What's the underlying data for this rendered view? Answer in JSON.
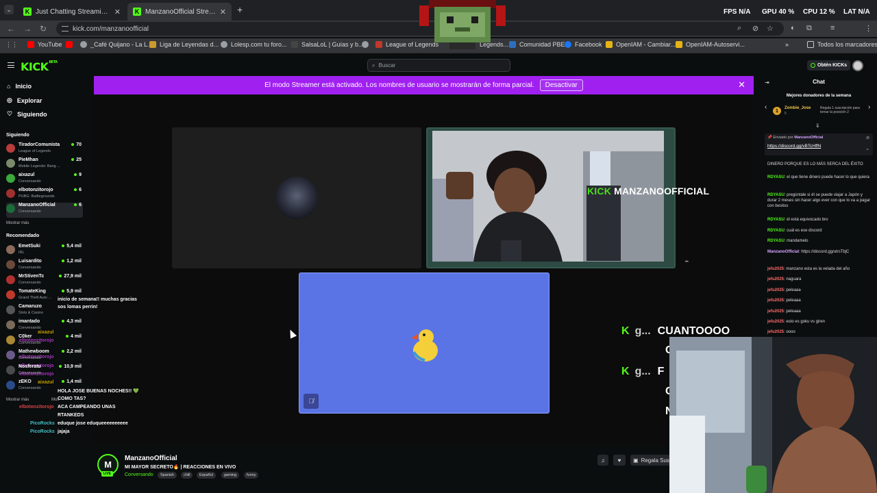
{
  "browser": {
    "tabs": [
      {
        "label": "Just Chatting Streaming - Live S"
      },
      {
        "label": "ManzanoOfficial Stream - Watc"
      }
    ],
    "url": "kick.com/manzanoofficial",
    "bookmarks": [
      {
        "label": "YouTube",
        "color": "#ff0000"
      },
      {
        "label": "_Café Quijano - La L...",
        "color": "#ff0000"
      },
      {
        "label": "Liga de Leyendas d...",
        "color": "#c99b2e"
      },
      {
        "label": "Lolesp.com tu foro...",
        "color": "#9aa0a6"
      },
      {
        "label": "SalsaLoL | Guías y b...",
        "color": "#3a3a3a"
      },
      {
        "label": "",
        "color": "#9aa0a6"
      },
      {
        "label": "League of Legends",
        "color": "#c0392b"
      },
      {
        "label": "Legends...",
        "color": "#555"
      },
      {
        "label": "Comunidad PBE",
        "color": "#2d6fbf"
      },
      {
        "label": "Facebook",
        "color": "#1877f2"
      },
      {
        "label": "OpenIAM - Cambiar...",
        "color": "#e7b416"
      },
      {
        "label": "OpenIAM-Autoservi...",
        "color": "#e7b416"
      }
    ],
    "all_bookmarks": "Todos los marcadores"
  },
  "overlay_stats": {
    "fps_label": "FPS",
    "fps": "N/A",
    "gpu_label": "GPU",
    "gpu": "40 %",
    "cpu_label": "CPU",
    "cpu": "12 %",
    "lat_label": "LAT",
    "lat": "N/A"
  },
  "kick": {
    "logo": "KICK",
    "logo_tag": "BETA",
    "search_placeholder": "Buscar",
    "get_kicks": "Obtén KICKs",
    "nav": {
      "home": "Inicio",
      "explore": "Explorar",
      "following": "Siguiendo"
    },
    "following_title": "Siguiendo",
    "following": [
      {
        "name": "TiradorComunista",
        "category": "League of Legends",
        "viewers": "70",
        "color": "#b83c3c"
      },
      {
        "name": "PieMhan",
        "category": "Mobile Legends: Bang ...",
        "viewers": "25",
        "color": "#7a8a6a"
      },
      {
        "name": "aixazul",
        "category": "Conversando",
        "viewers": "9",
        "color": "#3aa83a"
      },
      {
        "name": "elbotonzitorojo",
        "category": "PUBG: Battlegrounds",
        "viewers": "6",
        "color": "#a03030"
      },
      {
        "name": "ManzanoOfficial",
        "category": "Conversando",
        "viewers": "6",
        "color": "#1c6b3a"
      }
    ],
    "show_more": "Mostrar más",
    "recommended_title": "Recomendado",
    "recommended": [
      {
        "name": "EmetSuki",
        "category": "IRL",
        "viewers": "5,4 mil",
        "color": "#8c6a5a"
      },
      {
        "name": "Luisardito",
        "category": "Conversando",
        "viewers": "1,2 mil",
        "color": "#6a4a3a"
      },
      {
        "name": "MrStivenTc",
        "category": "Conversando",
        "viewers": "27,9 mil",
        "color": "#b03030"
      },
      {
        "name": "TomateKing",
        "category": "Grand Theft Auto ...",
        "viewers": "5,9 mil",
        "color": "#c0392b"
      },
      {
        "name": "Camaruzo",
        "category": "Slots & Casino",
        "viewers": "",
        "color": "#555555"
      },
      {
        "name": "imantado",
        "category": "Conversando",
        "viewers": "4,3 mil",
        "color": "#7a6a5a"
      },
      {
        "name": "C0ker",
        "category": "Conversando",
        "viewers": "4 mil",
        "color": "#aa8833"
      },
      {
        "name": "Mathewboom",
        "category": "Conversando",
        "viewers": "2,2 mil",
        "color": "#6a5a8a"
      },
      {
        "name": "Nosferatu",
        "category": "Conversando",
        "viewers": "10,9 mil",
        "color": "#4a4a4a"
      },
      {
        "name": "zEKO",
        "category": "Conversando",
        "viewers": "1,4 mil",
        "color": "#2a4a8a"
      }
    ],
    "show_more_2": "Mostrar más",
    "show_more_2b": "Mos"
  },
  "banner": {
    "text": "El modo Streamer está activado. Los nombres de usuario se mostrarán de forma parcial.",
    "button": "Desactivar",
    "close": "✕"
  },
  "video": {
    "cam_text_brand": "KICK",
    "cam_text": "MANZANOOFFICIAL",
    "kg_lines": [
      {
        "g": "g...",
        "text": "CUANTOOOO"
      },
      {
        "g": "g...",
        "text": ""
      }
    ],
    "kg_partial": [
      "C",
      "F",
      "C",
      "N"
    ]
  },
  "overlay_chat": [
    {
      "user": "",
      "text": "inicio de semana!! muchas gracias",
      "color": "#ffffff"
    },
    {
      "user": "",
      "text": "sos lomas perrin!",
      "color": "#ffffff"
    },
    {
      "user": "aixazul",
      "text": "",
      "color": "#c9a400"
    },
    {
      "user": "elbotonzitorojo",
      "text": "",
      "color": "#a83bc0"
    },
    {
      "user": "elbotonzitorojo",
      "text": "",
      "color": "#a83bc0"
    },
    {
      "user": "elbotonzitorojo",
      "text": "",
      "color": "#a83bc0"
    },
    {
      "user": "elbotonzitorojo",
      "text": "",
      "color": "#a83bc0"
    },
    {
      "user": "aixazul",
      "text": "",
      "color": "#c9a400"
    },
    {
      "user": "",
      "text": "HOLA JOSE BUENAS NOCHES!! 💚",
      "color": "#ffffff"
    },
    {
      "user": "",
      "text": "COMO TAS?",
      "color": "#ffffff"
    },
    {
      "user": "elbotonzitorojo",
      "text": "ACA CAMPEANDO UNAS",
      "color": "#d94b4b"
    },
    {
      "user": "",
      "text": "RTANKEDS",
      "color": "#ffffff"
    },
    {
      "user": "PicoRocks",
      "text": "eduque jose eduqueeeeeeeeee",
      "color": "#4bc2c9"
    },
    {
      "user": "PicoRocks",
      "text": "jajaja",
      "color": "#4bc2c9"
    }
  ],
  "stream_info": {
    "avatar_letter": "M",
    "live": "LIVE",
    "name": "ManzanoOfficial",
    "title": "MI MAYOR SECRETO🔥 | REACCIONES EN VIVO",
    "category": "Conversando",
    "tags": [
      "Spanish",
      "chill",
      "Español",
      "gaming",
      "funny"
    ],
    "gift_label": "Regala Sus"
  },
  "chat": {
    "title": "Chat",
    "donors_title": "Mejores donadores de la semana",
    "donor": {
      "rank": "1",
      "name": "Zombie_Jose",
      "amount": "5",
      "gift_text": "Regala 1 suscripción para tomar la posición 2"
    },
    "pinned_by": "Enviado por",
    "pinned_user": "ManzanoOfficial",
    "pinned_link": "https://discord.gg/vBTcHffN",
    "messages": [
      {
        "user": "",
        "text": "DINERO PORQUE ES LO MÁS SERCA DEL ÉXITO",
        "uc": ""
      },
      {
        "user": "RDYASU",
        "text": ": el que tiene dinero puede hacer lo que quiera",
        "uc": ""
      },
      {
        "user": "RDYASU",
        "text": ": pregúntale si él se puede viajar a Japón y durar 2 meses sin hacer algo ever con que lo va a pagar con besitos",
        "uc": ""
      },
      {
        "user": "RDYASU",
        "text": ": él está equivocado bro",
        "uc": ""
      },
      {
        "user": "RDYASU",
        "text": ": cuál es ese discord",
        "uc": ""
      },
      {
        "user": "RDYASU",
        "text": ": mandamelo",
        "uc": ""
      },
      {
        "user": "ManzanoOfficial",
        "text": ": https://discord.gg/utrsTbjC",
        "uc": "p"
      },
      {
        "user": "jefu2025",
        "text": ": manzano esta es la velada del año",
        "uc": "r"
      },
      {
        "user": "jefu2025",
        "text": ": naguara",
        "uc": "r"
      },
      {
        "user": "jefu2025",
        "text": ": peleaaa",
        "uc": "r"
      },
      {
        "user": "jefu2025",
        "text": ": peleaaa",
        "uc": "r"
      },
      {
        "user": "jefu2025",
        "text": ": peleaaa",
        "uc": "r"
      },
      {
        "user": "jefu2025",
        "text": ": esto es goku vs giren",
        "uc": "r"
      },
      {
        "user": "jefu2025",
        "text": ": oooo",
        "uc": "r"
      }
    ]
  },
  "colors": {
    "kick_green": "#53fc18",
    "banner_purple": "#a020f0",
    "tile_blue": "#5a74e5",
    "cam_border": "#2d4a43"
  },
  "icons": [
    "menu-icon",
    "search-icon",
    "home-icon",
    "compass-icon",
    "heart-icon",
    "close-icon",
    "mic-muted-icon",
    "bell-icon",
    "gift-icon",
    "chevron-left-icon",
    "chevron-right-icon",
    "pin-icon"
  ]
}
